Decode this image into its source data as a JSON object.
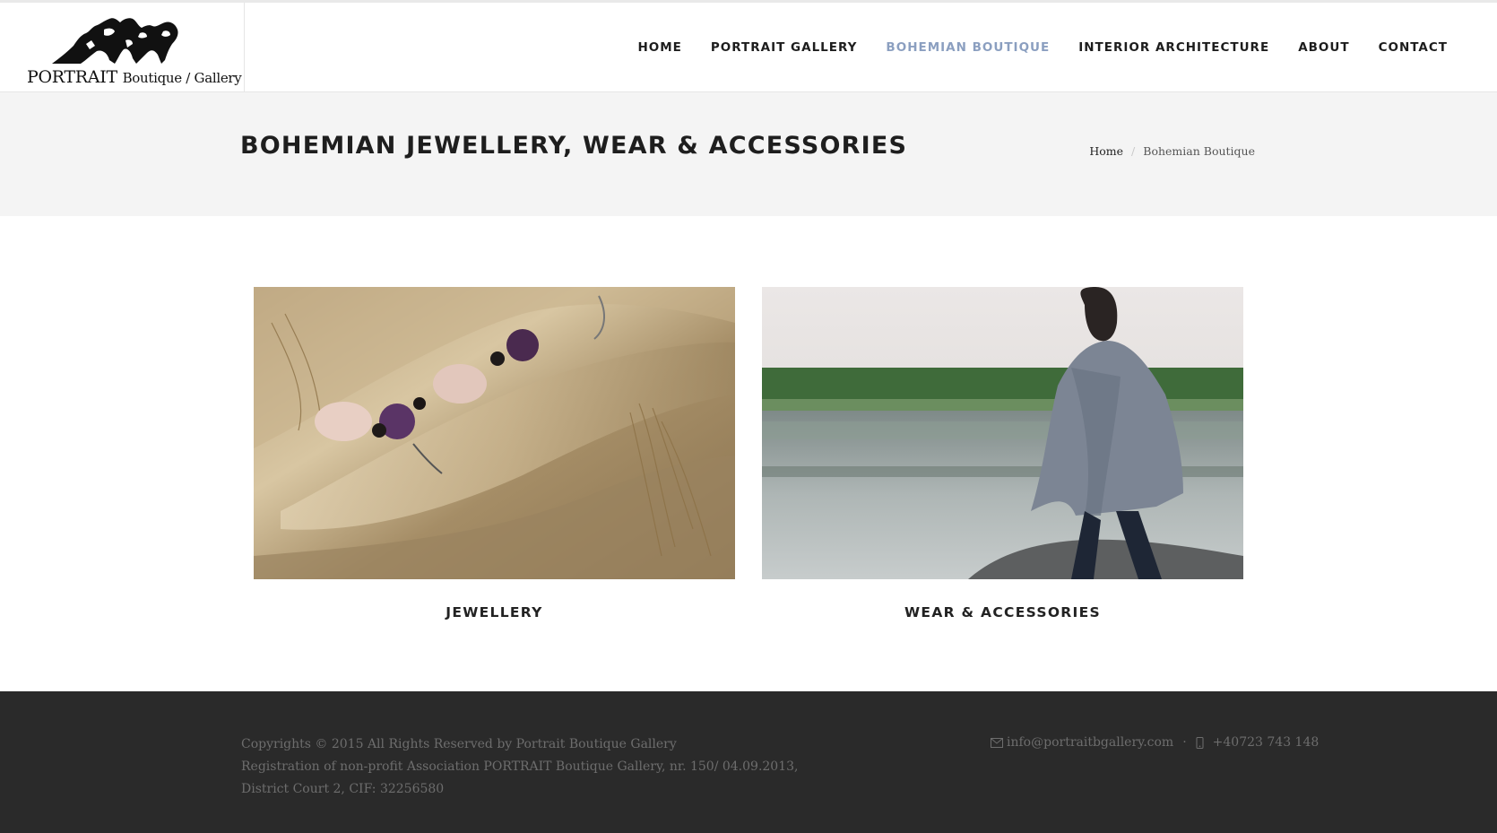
{
  "logo": {
    "brand": "PORTRAIT",
    "tagline": "Boutique / Gallery"
  },
  "nav": {
    "items": [
      {
        "label": "HOME"
      },
      {
        "label": "PORTRAIT GALLERY"
      },
      {
        "label": "BOHEMIAN BOUTIQUE",
        "active": true
      },
      {
        "label": "INTERIOR ARCHITECTURE"
      },
      {
        "label": "ABOUT"
      },
      {
        "label": "CONTACT"
      }
    ],
    "active_color": "#8b9fc0"
  },
  "page": {
    "title": "BOHEMIAN JEWELLERY, WEAR & ACCESSORIES"
  },
  "breadcrumb": {
    "home": "Home",
    "current": "Bohemian Boutique"
  },
  "gallery": {
    "items": [
      {
        "title": "JEWELLERY"
      },
      {
        "title": "WEAR & ACCESSORIES"
      }
    ]
  },
  "footer": {
    "copyright": "Copyrights © 2015 All Rights Reserved by Portrait Boutique Gallery",
    "registration_1": "Registration of non-profit Association PORTRAIT Boutique Gallery, nr. 150/ 04.09.2013,",
    "registration_2": "District Court 2, CIF: 32256580",
    "email": "info@portraitbgallery.com",
    "phone": "+40723 743 148",
    "separator": "·"
  }
}
